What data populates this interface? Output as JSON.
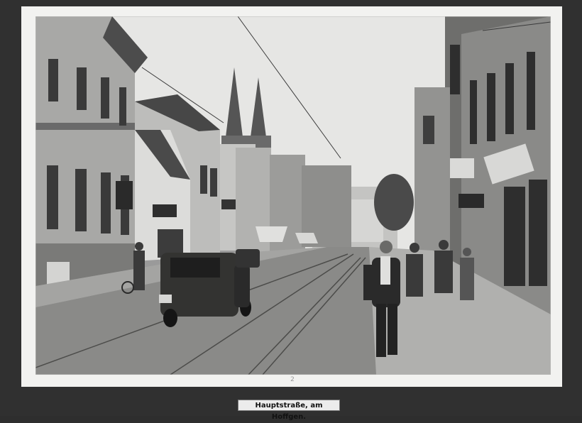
{
  "photo": {
    "caption": "Hauptstraße, am Hoffgen.",
    "page_number": "2",
    "palette": {
      "sky": "#e4e4e2",
      "street": "#8c8c8a",
      "sidewalk": "#a6a6a4",
      "dark": "#2a2a2a",
      "mid": "#6a6a6a",
      "light": "#c8c8c6"
    }
  }
}
